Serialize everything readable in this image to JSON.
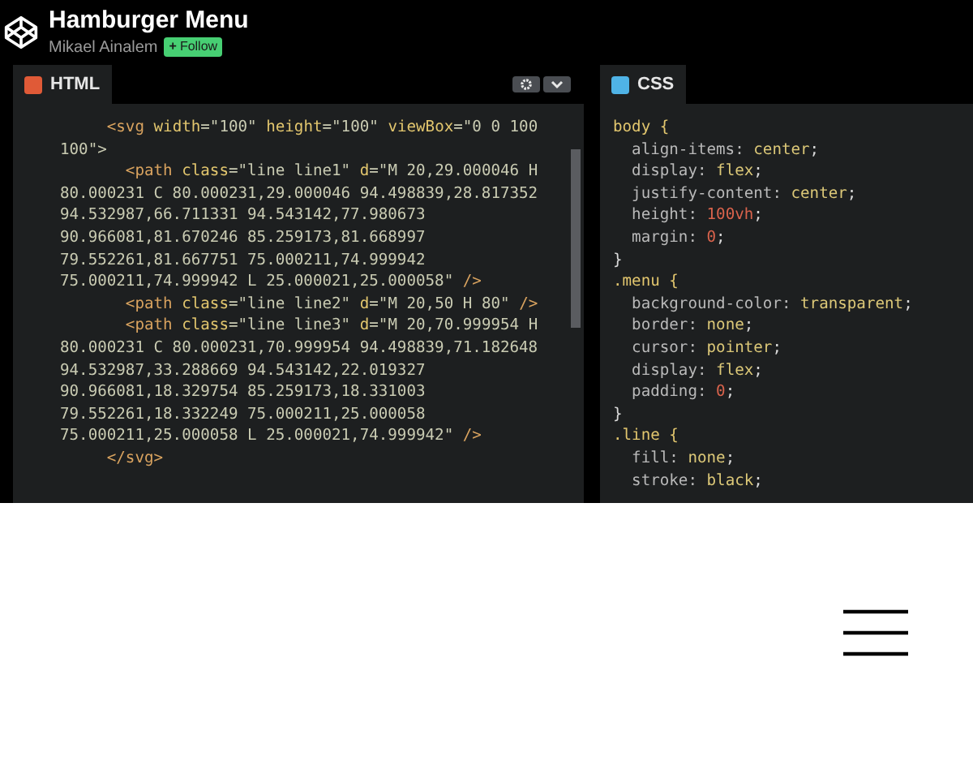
{
  "header": {
    "title": "Hamburger Menu",
    "author": "Mikael Ainalem",
    "follow_button": {
      "icon": "+",
      "label": "Follow"
    }
  },
  "editors": [
    {
      "kind": "html",
      "tab": "HTML",
      "lines": [
        [
          {
            "kind": "tag",
            "text": "     <svg "
          },
          {
            "kind": "attr",
            "text": "width"
          },
          {
            "kind": "plain",
            "text": "=\"100\" "
          },
          {
            "kind": "attr",
            "text": "height"
          },
          {
            "kind": "plain",
            "text": "=\"100\" "
          },
          {
            "kind": "attr",
            "text": "viewBox"
          },
          {
            "kind": "plain",
            "text": "=\"0 0 100"
          }
        ],
        [
          {
            "kind": "plain",
            "text": "100\">"
          }
        ],
        [
          {
            "kind": "tag",
            "text": "       <path "
          },
          {
            "kind": "attr",
            "text": "class"
          },
          {
            "kind": "plain",
            "text": "=\"line line1\" "
          },
          {
            "kind": "attr",
            "text": "d"
          },
          {
            "kind": "plain",
            "text": "=\"M 20,29.000046 H"
          }
        ],
        [
          {
            "kind": "plain",
            "text": "80.000231 C 80.000231,29.000046 94.498839,28.817352"
          }
        ],
        [
          {
            "kind": "plain",
            "text": "94.532987,66.711331 94.543142,77.980673"
          }
        ],
        [
          {
            "kind": "plain",
            "text": "90.966081,81.670246 85.259173,81.668997"
          }
        ],
        [
          {
            "kind": "plain",
            "text": "79.552261,81.667751 75.000211,74.999942"
          }
        ],
        [
          {
            "kind": "plain",
            "text": "75.000211,74.999942 L 25.000021,25.000058\" "
          },
          {
            "kind": "tag",
            "text": "/>"
          }
        ],
        [
          {
            "kind": "tag",
            "text": "       <path "
          },
          {
            "kind": "attr",
            "text": "class"
          },
          {
            "kind": "plain",
            "text": "=\"line line2\" "
          },
          {
            "kind": "attr",
            "text": "d"
          },
          {
            "kind": "plain",
            "text": "=\"M 20,50 H 80\" "
          },
          {
            "kind": "tag",
            "text": "/>"
          }
        ],
        [
          {
            "kind": "tag",
            "text": "       <path "
          },
          {
            "kind": "attr",
            "text": "class"
          },
          {
            "kind": "plain",
            "text": "=\"line line3\" "
          },
          {
            "kind": "attr",
            "text": "d"
          },
          {
            "kind": "plain",
            "text": "=\"M 20,70.999954 H"
          }
        ],
        [
          {
            "kind": "plain",
            "text": "80.000231 C 80.000231,70.999954 94.498839,71.182648"
          }
        ],
        [
          {
            "kind": "plain",
            "text": "94.532987,33.288669 94.543142,22.019327"
          }
        ],
        [
          {
            "kind": "plain",
            "text": "90.966081,18.329754 85.259173,18.331003"
          }
        ],
        [
          {
            "kind": "plain",
            "text": "79.552261,18.332249 75.000211,25.000058"
          }
        ],
        [
          {
            "kind": "plain",
            "text": "75.000211,25.000058 L 25.000021,74.999942\" "
          },
          {
            "kind": "tag",
            "text": "/>"
          }
        ],
        [
          {
            "kind": "tag",
            "text": "     </svg>"
          }
        ]
      ]
    },
    {
      "kind": "css",
      "tab": "CSS",
      "lines": [
        [
          {
            "kind": "selector",
            "text": "body {"
          }
        ],
        [
          {
            "kind": "property",
            "text": "  align-items: "
          },
          {
            "kind": "value",
            "text": "center"
          },
          {
            "kind": "punct",
            "text": ";"
          }
        ],
        [
          {
            "kind": "property",
            "text": "  display: "
          },
          {
            "kind": "value",
            "text": "flex"
          },
          {
            "kind": "punct",
            "text": ";"
          }
        ],
        [
          {
            "kind": "property",
            "text": "  justify-content: "
          },
          {
            "kind": "value",
            "text": "center"
          },
          {
            "kind": "punct",
            "text": ";"
          }
        ],
        [
          {
            "kind": "property",
            "text": "  height: "
          },
          {
            "kind": "number",
            "text": "100vh"
          },
          {
            "kind": "punct",
            "text": ";"
          }
        ],
        [
          {
            "kind": "property",
            "text": "  margin: "
          },
          {
            "kind": "number",
            "text": "0"
          },
          {
            "kind": "punct",
            "text": ";"
          }
        ],
        [
          {
            "kind": "punct",
            "text": "}"
          }
        ],
        [
          {
            "kind": "selector",
            "text": ".menu {"
          }
        ],
        [
          {
            "kind": "property",
            "text": "  background-color: "
          },
          {
            "kind": "value",
            "text": "transparent"
          },
          {
            "kind": "punct",
            "text": ";"
          }
        ],
        [
          {
            "kind": "property",
            "text": "  border: "
          },
          {
            "kind": "value",
            "text": "none"
          },
          {
            "kind": "punct",
            "text": ";"
          }
        ],
        [
          {
            "kind": "property",
            "text": "  cursor: "
          },
          {
            "kind": "value",
            "text": "pointer"
          },
          {
            "kind": "punct",
            "text": ";"
          }
        ],
        [
          {
            "kind": "property",
            "text": "  display: "
          },
          {
            "kind": "value",
            "text": "flex"
          },
          {
            "kind": "punct",
            "text": ";"
          }
        ],
        [
          {
            "kind": "property",
            "text": "  padding: "
          },
          {
            "kind": "number",
            "text": "0"
          },
          {
            "kind": "punct",
            "text": ";"
          }
        ],
        [
          {
            "kind": "punct",
            "text": "}"
          }
        ],
        [
          {
            "kind": "selector",
            "text": ".line {"
          }
        ],
        [
          {
            "kind": "property",
            "text": "  fill: "
          },
          {
            "kind": "value",
            "text": "none"
          },
          {
            "kind": "punct",
            "text": ";"
          }
        ],
        [
          {
            "kind": "property",
            "text": "  stroke: "
          },
          {
            "kind": "value",
            "text": "black"
          },
          {
            "kind": "punct",
            "text": ";"
          }
        ]
      ]
    }
  ]
}
